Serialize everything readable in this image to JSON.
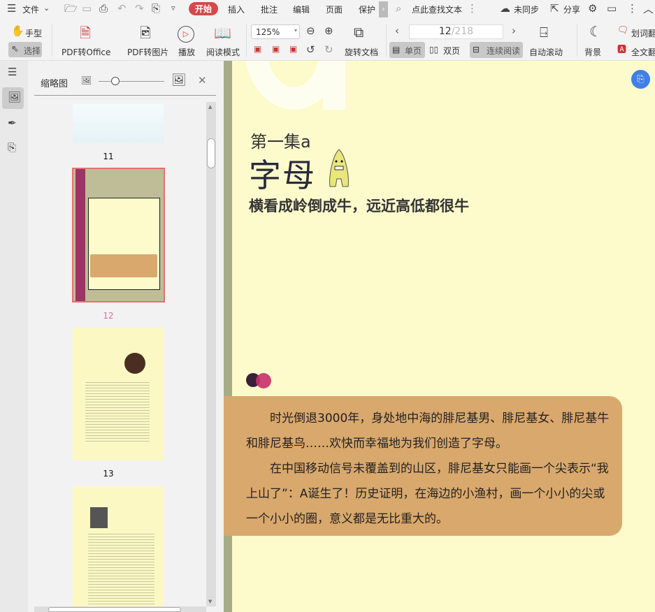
{
  "tabbar": {
    "menu": "文件",
    "tabs": [
      "开始",
      "插入",
      "批注",
      "编辑",
      "页面",
      "保护"
    ],
    "search": "点此查找文本",
    "sync": "未同步",
    "share": "分享"
  },
  "toolbar": {
    "hand": "手型",
    "select": "选择",
    "pdf_office": "PDF转Office",
    "pdf_image": "PDF转图片",
    "play": "播放",
    "read_mode": "阅读模式",
    "zoom": "125%",
    "rotate_doc": "旋转文档",
    "page_current": "12",
    "page_total": "/218",
    "single": "单页",
    "double": "双页",
    "continuous": "连续阅读",
    "auto_scroll": "自动滚动",
    "background": "背景",
    "word_translate": "划词翻",
    "full_translate": "全文翻"
  },
  "panel": {
    "title": "缩略图",
    "slider_value": 0.25,
    "thumbs": [
      "11",
      "12",
      "13"
    ]
  },
  "page": {
    "episode": "第一集a",
    "title": "字母",
    "subtitle": "横看成岭倒成牛，远近高低都很牛",
    "para1": "时光倒退3000年，身处地中海的腓尼基男、腓尼基女、腓尼基牛和腓尼基鸟……欢快而幸福地为我们创造了字母。",
    "para2": "在中国移动信号未覆盖到的山区，腓尼基女只能画一个尖表示“我上山了”：A诞生了！历史证明，在海边的小渔村，画一个小小的尖或一个小小的圈，意义都是无比重大的。"
  },
  "colors": {
    "accent": "#d44a4a",
    "selected_thumb": "#e87070",
    "box": "#d9a86c",
    "page_bg": "#fdfbcc"
  }
}
